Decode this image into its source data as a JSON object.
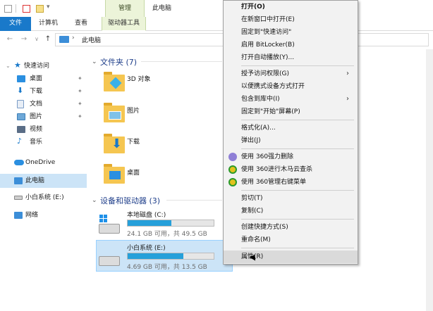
{
  "titlebar": {
    "context_tab": "管理",
    "window_title": "此电脑"
  },
  "ribbon": {
    "tabs": [
      "文件",
      "计算机",
      "查看",
      "驱动器工具"
    ]
  },
  "address": {
    "path": "此电脑"
  },
  "nav": {
    "items": [
      {
        "label": "快速访问",
        "pinned": false
      },
      {
        "label": "桌面",
        "pinned": true
      },
      {
        "label": "下载",
        "pinned": true
      },
      {
        "label": "文档",
        "pinned": true
      },
      {
        "label": "图片",
        "pinned": true
      },
      {
        "label": "视频",
        "pinned": false
      },
      {
        "label": "音乐",
        "pinned": false
      },
      {
        "label": "OneDrive",
        "pinned": false
      },
      {
        "label": "此电脑",
        "pinned": false
      },
      {
        "label": "小白系统 (E:)",
        "pinned": false
      },
      {
        "label": "网络",
        "pinned": false
      }
    ]
  },
  "content": {
    "folders_heading": "文件夹 (7)",
    "folders": [
      "3D 对象",
      "图片",
      "下载",
      "桌面"
    ],
    "drives_heading": "设备和驱动器 (3)",
    "drives": [
      {
        "name": "本地磁盘 (C:)",
        "free": "24.1 GB 可用，共 49.5 GB",
        "used_fraction": 0.51
      },
      {
        "name": "小白系统 (E:)",
        "free": "4.69 GB 可用，共 13.5 GB",
        "used_fraction": 0.65
      }
    ]
  },
  "menu": {
    "items": [
      {
        "label": "打开(O)",
        "bold": true
      },
      {
        "label": "在新窗口中打开(E)"
      },
      {
        "label": "固定到\"快速访问\""
      },
      {
        "label": "启用 BitLocker(B)"
      },
      {
        "label": "打开自动播放(Y)..."
      },
      {
        "label": "授予访问权限(G)",
        "submenu": true
      },
      {
        "label": "以便携式设备方式打开"
      },
      {
        "label": "包含到库中(I)",
        "submenu": true
      },
      {
        "label": "固定到\"开始\"屏幕(P)"
      },
      {
        "label": "格式化(A)..."
      },
      {
        "label": "弹出(J)"
      },
      {
        "label": "使用 360强力删除"
      },
      {
        "label": "使用 360进行木马云查杀"
      },
      {
        "label": "使用 360管理右键菜单"
      },
      {
        "label": "剪切(T)"
      },
      {
        "label": "复制(C)"
      },
      {
        "label": "创建快捷方式(S)"
      },
      {
        "label": "重命名(M)"
      },
      {
        "label": "属性(R)"
      }
    ]
  },
  "colors": {
    "accent": "#1979ca",
    "selection": "#cce4f7",
    "progress": "#26a0da",
    "menu_bg": "#f2f2f2"
  }
}
